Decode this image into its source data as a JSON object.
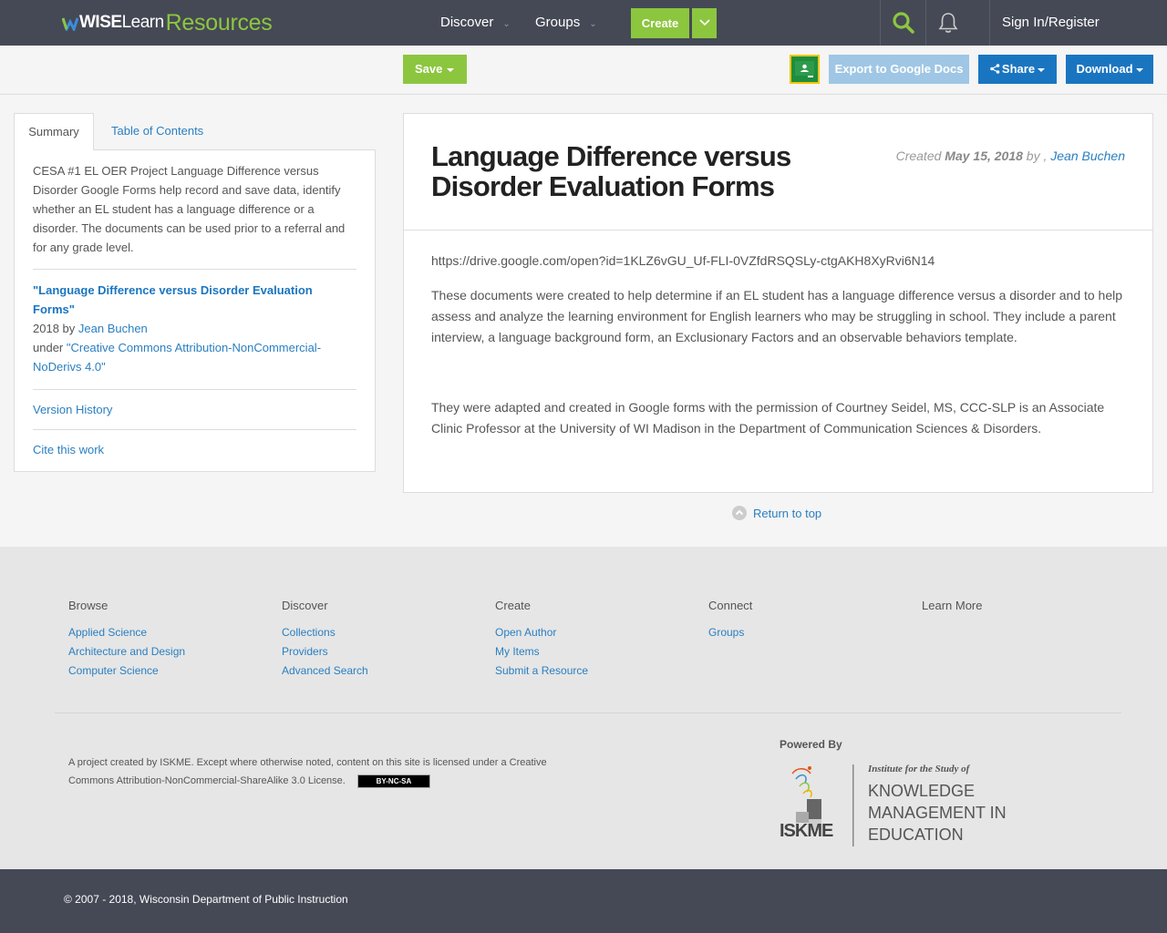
{
  "brand": {
    "logo_prefix": "WISE",
    "logo_learn": "Learn",
    "logo_suffix": "Resources"
  },
  "nav": {
    "discover": "Discover",
    "groups": "Groups",
    "create": "Create",
    "signin": "Sign In/Register"
  },
  "toolbar": {
    "save": "Save",
    "export": "Export to Google Docs",
    "share": "Share",
    "download": "Download"
  },
  "sidebar": {
    "tabs": [
      "Summary",
      "Table of Contents"
    ],
    "summary": "CESA #1 EL OER Project Language Difference versus Disorder Google Forms help record and save data, identify whether an EL student has a language difference or a disorder. The documents can be used prior to a referral and for any grade level.",
    "attribution": {
      "title": "\"Language Difference versus Disorder Evaluation Forms\"",
      "year_by": "2018 by",
      "author": "Jean Buchen",
      "under": "under",
      "license": "\"Creative Commons Attribution-NonCommercial-NoDerivs 4.0\""
    },
    "version_history": "Version History",
    "cite": "Cite this work"
  },
  "resource": {
    "title": "Language Difference versus Disorder Evaluation Forms",
    "created_label": "Created",
    "created_date": "May 15, 2018",
    "by": "by ,",
    "author": "Jean Buchen",
    "url": "https://drive.google.com/open?id=1KLZ6vGU_Uf-FLI-0VZfdRSQSLy-ctgAKH8XyRvi6N14",
    "para1": "These documents were created to help determine if an EL student has a language difference versus a disorder and to help assess and analyze the learning environment for English learners who may be struggling in school. They include a parent interview, a language background form, an Exclusionary Factors and an observable behaviors template.",
    "para2": "They were adapted and created in Google forms with the permission of Courtney Seidel, MS, CCC-SLP is an Associate Clinic Professor at the University of WI Madison in the Department of Communication Sciences & Disorders."
  },
  "return_top": "Return to top",
  "footer": {
    "browse": {
      "heading": "Browse",
      "links": [
        "Applied Science",
        "Architecture and Design",
        "Computer Science"
      ]
    },
    "discover": {
      "heading": "Discover",
      "links": [
        "Collections",
        "Providers",
        "Advanced Search"
      ]
    },
    "create": {
      "heading": "Create",
      "links": [
        "Open Author",
        "My Items",
        "Submit a Resource"
      ]
    },
    "connect": {
      "heading": "Connect",
      "links": [
        "Groups"
      ]
    },
    "learn_more": {
      "heading": "Learn More"
    },
    "license_text": "A project created by ISKME. Except where otherwise noted, content on this site is licensed under a Creative Commons Attribution-NonCommercial-ShareAlike 3.0 License.",
    "cc_badge": "BY-NC-SA",
    "powered_by": "Powered By",
    "iskme_line1": "Institute for the Study of",
    "iskme_line2": "KNOWLEDGE",
    "iskme_line3": "MANAGEMENT IN",
    "iskme_line4": "EDUCATION",
    "iskme_word": "ISKME",
    "copyright": "© 2007 - 2018, Wisconsin Department of Public Instruction"
  },
  "colors": {
    "nav_bg": "#454955",
    "accent_green": "#8cc63f",
    "primary_blue": "#1a75c0",
    "link_blue": "#2a7fc1"
  }
}
